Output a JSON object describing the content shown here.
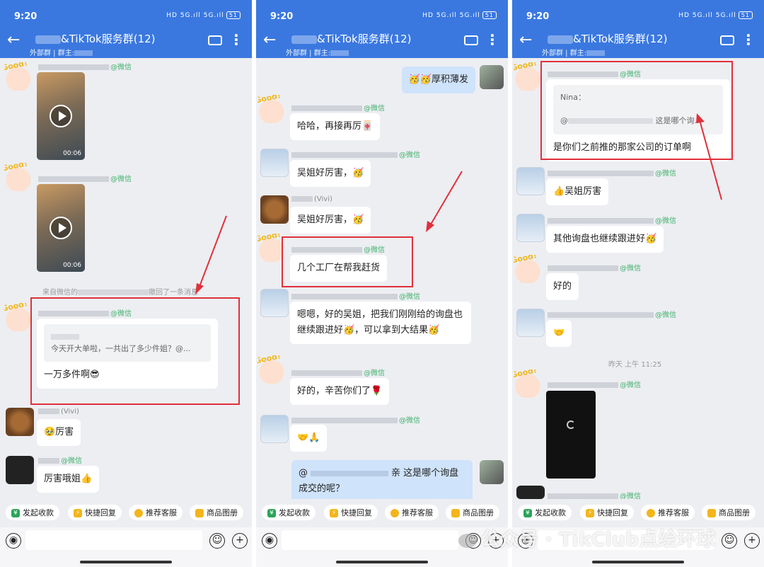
{
  "panels": [
    {
      "status": {
        "time": "9:20",
        "icons": "HD 5G.ıll 5G.ıll",
        "battery": "51"
      },
      "header": {
        "title": "&TikTok服务群(12)",
        "subtitle_prefix": "外部群",
        "subtitle_owner": "群主:"
      },
      "messages": {
        "m1_name_suffix": "@微信",
        "video1_duration": "00:06",
        "m2_name_suffix": "@微信",
        "video2_duration": "00:06",
        "recall_prefix": "来自微信的",
        "recall_suffix": "撤回了一条消息",
        "m3_name_suffix": "@微信",
        "m3_quote": "今天开大单啦，一共出了多少件姐？@...",
        "m3_text": "一万多件啊😎",
        "m4_name": "(Vivi)",
        "m4_text": "🥹厉害",
        "m5_name_suffix": "@微信",
        "m5_text": "厉害哦姐👍"
      }
    },
    {
      "status": {
        "time": "9:20",
        "icons": "HD 5G.ıll 5G.ıll",
        "battery": "51"
      },
      "header": {
        "title": "&TikTok服务群(12)",
        "subtitle_prefix": "外部群",
        "subtitle_owner": "群主:"
      },
      "messages": {
        "m1_text": "🥳🥳厚积薄发",
        "m2_name_suffix": "@微信",
        "m2_text": "哈哈，再接再厉🀄",
        "m3_name_suffix": "@微信",
        "m3_text": "吴姐好厉害，🥳",
        "m4_name": "(Vivi)",
        "m4_text": "吴姐好厉害，🥳",
        "m5_name_suffix": "@微信",
        "m5_text": "几个工厂在帮我赶货",
        "m6_name_suffix": "@微信",
        "m6_text": "嗯嗯，好的吴姐，把我们刚刚给的询盘也继续跟进好🥳，可以拿到大结果🥳",
        "m7_name_suffix": "@微信",
        "m7_text": "好的，辛苦你们了🌹",
        "m8_name_suffix": "@微信",
        "m8_text": "🤝🙏",
        "m9_prefix": "@",
        "m9_text": "亲 这是哪个询盘成交的呢？"
      }
    },
    {
      "status": {
        "time": "9:20",
        "icons": "HD 5G.ıll 5G.ıll",
        "battery": "51"
      },
      "header": {
        "title": "&TikTok服务群(12)",
        "subtitle_prefix": "外部群",
        "subtitle_owner": "群主:"
      },
      "messages": {
        "m1_name_suffix": "@微信",
        "m1_quote_name": "Nina：",
        "m1_quote_text": "这是哪个询...",
        "m1_text": "是你们之前推的那家公司的订单啊",
        "m2_name_suffix": "@微信",
        "m2_text": "👍吴姐厉害",
        "m3_name_suffix": "@微信",
        "m3_text": "其他询盘也继续跟进好🥳",
        "m4_name_suffix": "@微信",
        "m4_text": "好的",
        "m5_name_suffix": "@微信",
        "m5_text": "🤝",
        "time_divider": "昨天 上午 11:25",
        "m6_name_suffix": "@微信",
        "m7_name_suffix": "@微信"
      }
    }
  ],
  "toolbar": {
    "collect": "发起收款",
    "quick_reply": "快捷回复",
    "recommend": "推荐客服",
    "album": "商品图册"
  },
  "watermark": "公众号 · TikClub点绘环球",
  "colors": {
    "header": "#3a78e0",
    "highlight": "#e0303b",
    "wechat_tag": "#3fb16b"
  }
}
